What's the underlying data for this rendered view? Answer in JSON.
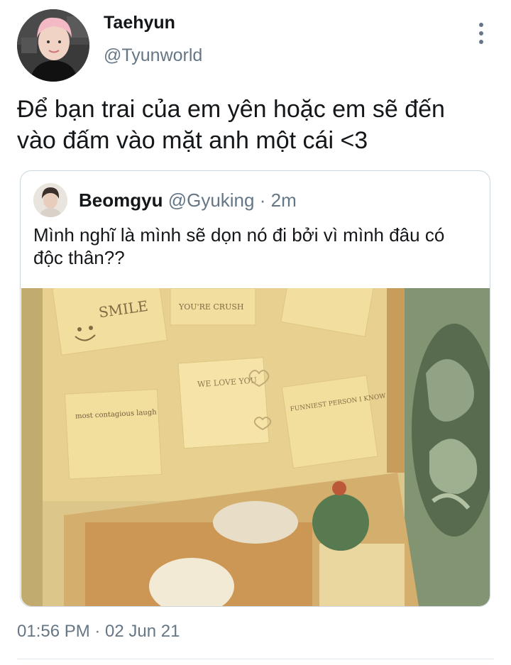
{
  "tweet": {
    "author": {
      "display_name": "Taehyun",
      "handle": "@Tyunworld"
    },
    "text": "Để bạn trai của em yên hoặc em sẽ đến vào đấm vào mặt anh một cái <3",
    "timestamp": "01:56 PM · 02 Jun 21",
    "more_icon": "more-vertical-icon"
  },
  "quote": {
    "author": {
      "display_name": "Beomgyu",
      "handle": "@Gyuking",
      "separator": "·",
      "time": "2m"
    },
    "text": "Mình nghĩ là mình sẽ dọn nó đi bởi vì mình đâu có độc thân??",
    "media": {
      "notes": [
        "SMILE",
        "YOU'RE CRUSH",
        "WE LOVE YOU",
        "most contagious laugh",
        "FUNNIEST PERSON I KNOW"
      ]
    }
  },
  "colors": {
    "text_primary": "#14171a",
    "text_secondary": "#657786",
    "border": "#ccd6dd"
  }
}
